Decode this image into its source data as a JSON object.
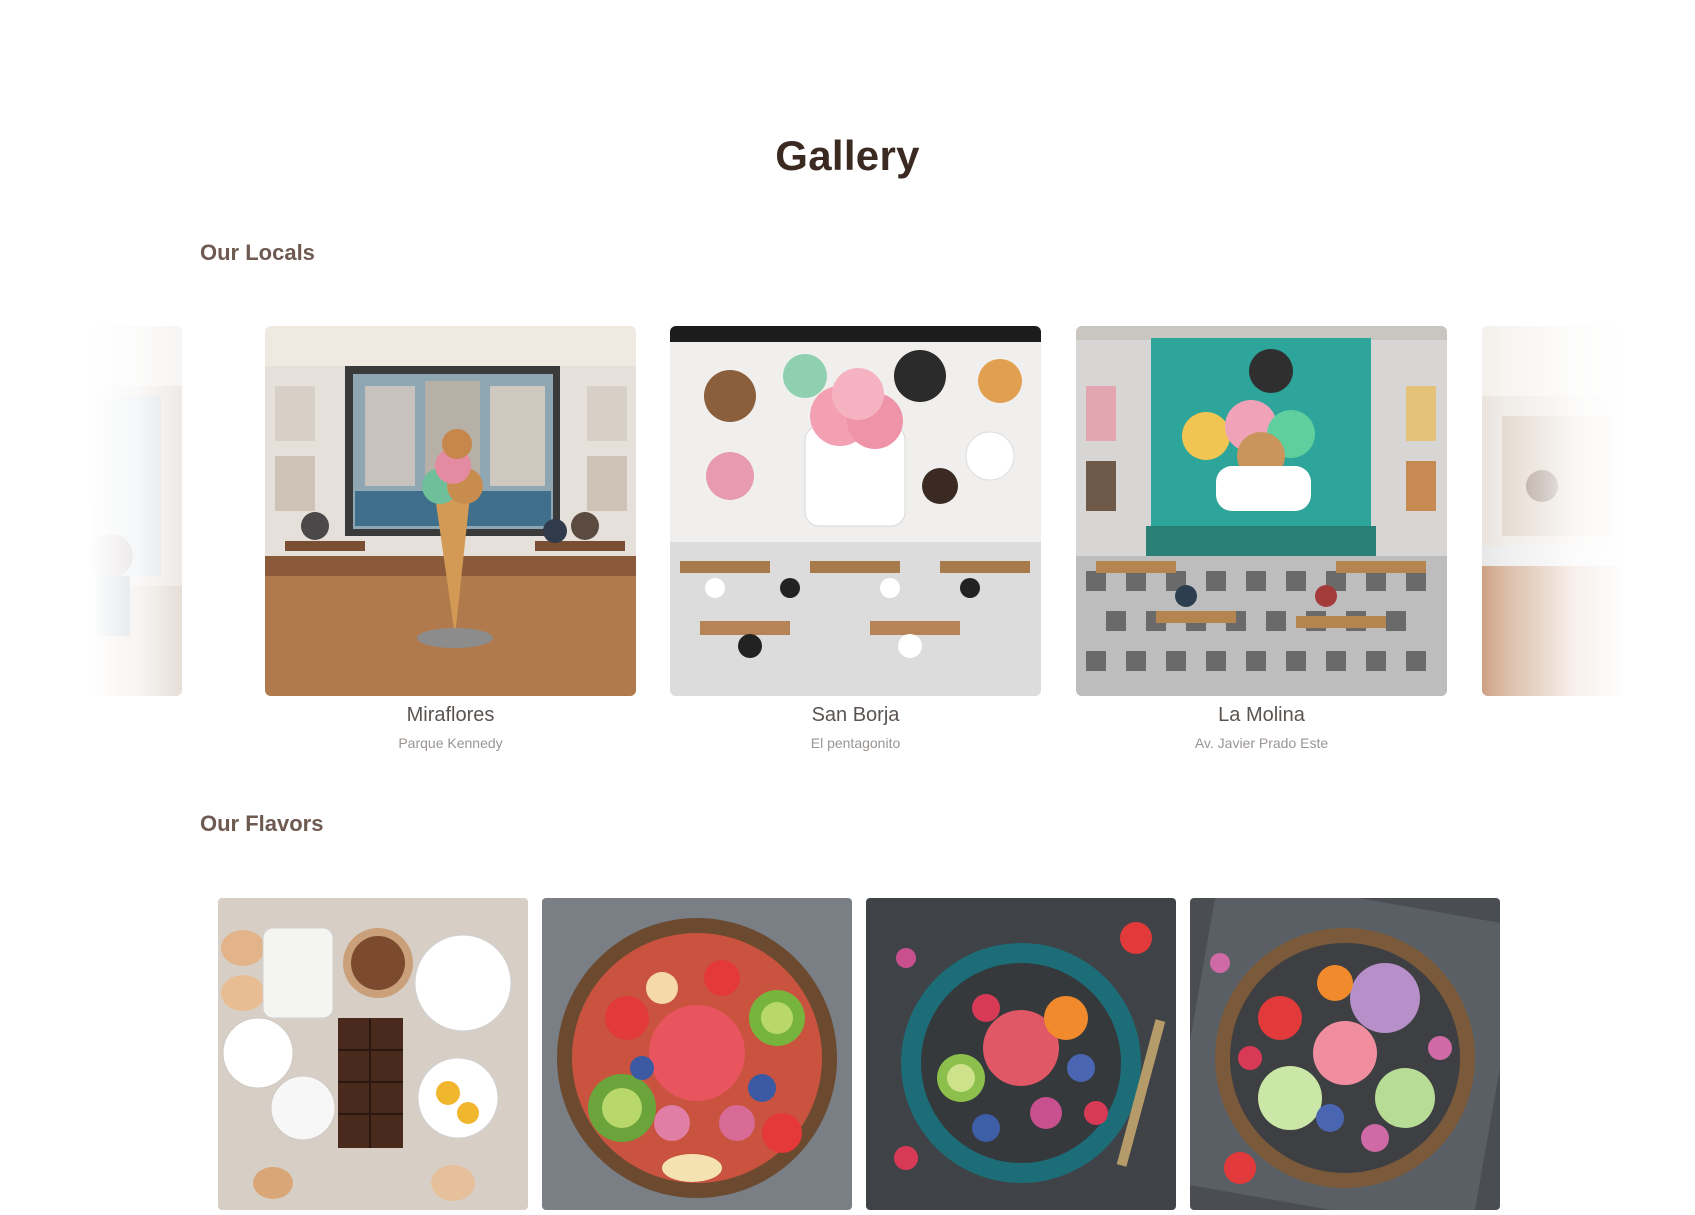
{
  "page": {
    "title": "Gallery"
  },
  "locals": {
    "heading": "Our Locals",
    "items": [
      {
        "name": "",
        "address": ""
      },
      {
        "name": "Miraflores",
        "address": "Parque Kennedy"
      },
      {
        "name": "San Borja",
        "address": "El pentagonito"
      },
      {
        "name": "La Molina",
        "address": "Av. Javier Prado Este"
      },
      {
        "name": "",
        "address": ""
      }
    ]
  },
  "flavors": {
    "heading": "Our Flavors",
    "items": [
      {
        "image": "baking-ingredients-photo"
      },
      {
        "image": "fruit-bowl-sorbet-photo"
      },
      {
        "image": "berry-sorbet-teal-bowl-photo"
      },
      {
        "image": "gelato-fruit-bowl-photo"
      }
    ]
  },
  "colors": {
    "title": "#3b2a22",
    "section_heading": "#6e5a51",
    "caption_name": "#5b5552",
    "caption_address": "#9b9592",
    "background": "#ffffff"
  }
}
